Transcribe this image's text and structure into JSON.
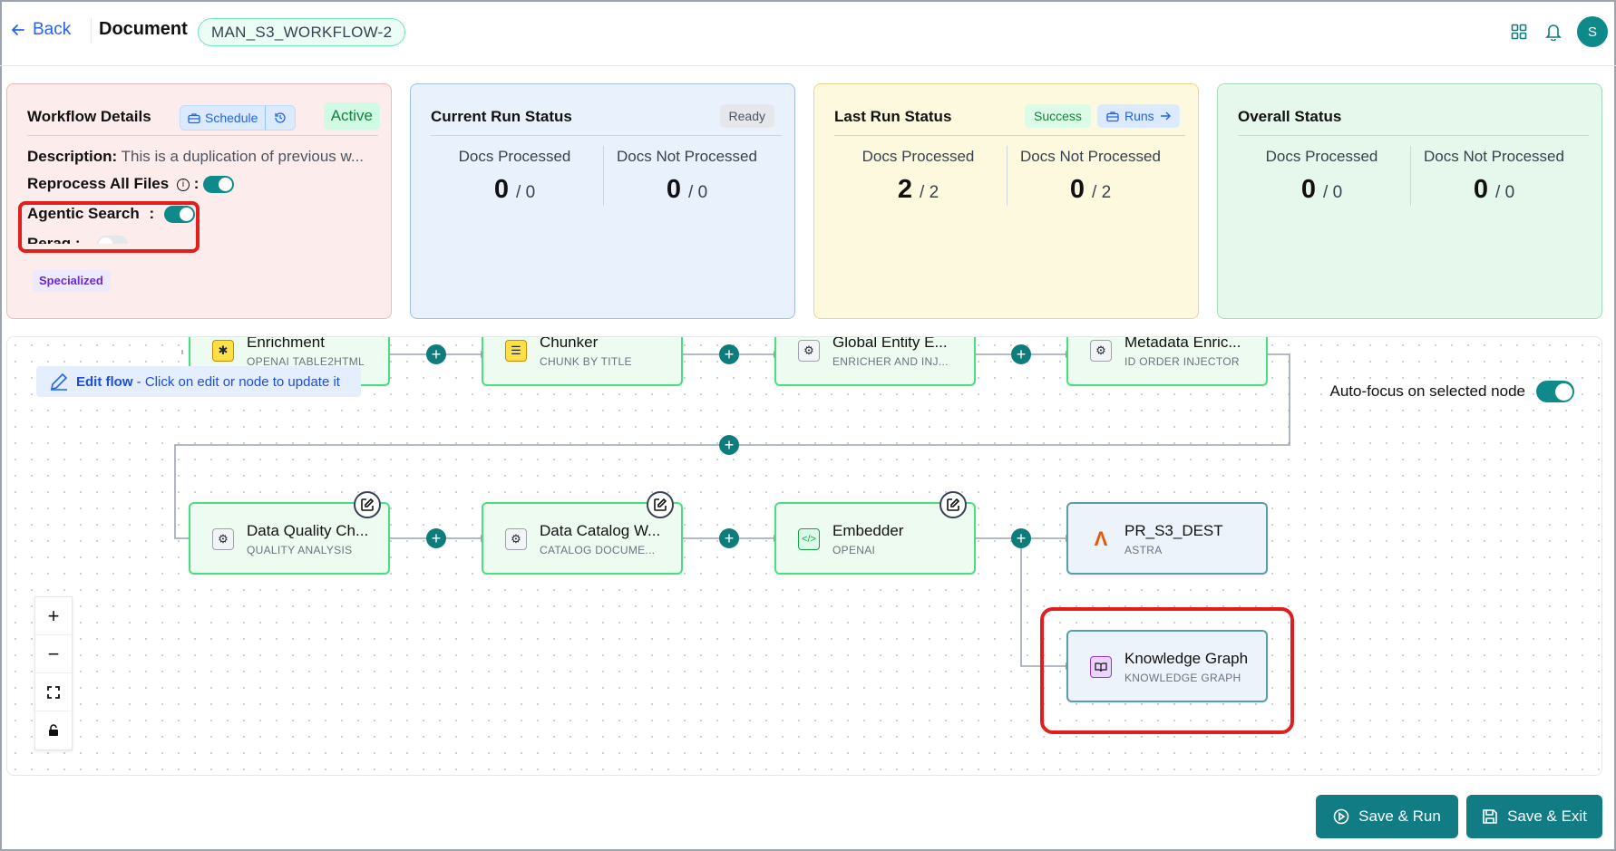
{
  "header": {
    "back_label": "Back",
    "title": "Document",
    "workflow_name": "MAN_S3_WORKFLOW-2",
    "avatar_initial": "S"
  },
  "workflow_details": {
    "title": "Workflow Details",
    "schedule_label": "Schedule",
    "status": "Active",
    "description_label": "Description:",
    "description_value": "This is a duplication of previous w...",
    "reprocess_label": "Reprocess All Files",
    "reprocess_on": true,
    "agentic_search_label": "Agentic Search",
    "agentic_search_on": true,
    "rerag_label": "Rerag",
    "rerag_on": false,
    "tag": "Specialized"
  },
  "current_run": {
    "title": "Current Run Status",
    "badge": "Ready",
    "processed_label": "Docs Processed",
    "processed": "0",
    "processed_total": "/ 0",
    "not_processed_label": "Docs Not Processed",
    "not_processed": "0",
    "not_processed_total": "/ 0"
  },
  "last_run": {
    "title": "Last Run Status",
    "badge": "Success",
    "runs_label": "Runs",
    "processed_label": "Docs Processed",
    "processed": "2",
    "processed_total": "/ 2",
    "not_processed_label": "Docs Not Processed",
    "not_processed": "0",
    "not_processed_total": "/ 2"
  },
  "overall": {
    "title": "Overall Status",
    "processed_label": "Docs Processed",
    "processed": "0",
    "processed_total": "/ 0",
    "not_processed_label": "Docs Not Processed",
    "not_processed": "0",
    "not_processed_total": "/ 0"
  },
  "canvas": {
    "edit_flow_bold": "Edit flow",
    "edit_flow_hint": " - Click on edit or node to update it",
    "autofocus_label": "Auto-focus on selected node",
    "autofocus_on": true,
    "nodes": [
      {
        "title": "Enrichment",
        "subtitle": "OPENAI TABLE2HTML",
        "icon": "star-icon"
      },
      {
        "title": "Chunker",
        "subtitle": "CHUNK BY TITLE",
        "icon": "list-icon"
      },
      {
        "title": "Global Entity E...",
        "subtitle": "ENRICHER AND INJ...",
        "icon": "puzzle-icon"
      },
      {
        "title": "Metadata Enric...",
        "subtitle": "ID ORDER INJECTOR",
        "icon": "puzzle-icon"
      },
      {
        "title": "Data Quality Ch...",
        "subtitle": "QUALITY ANALYSIS",
        "icon": "puzzle-icon"
      },
      {
        "title": "Data Catalog W...",
        "subtitle": "CATALOG DOCUME...",
        "icon": "puzzle-icon"
      },
      {
        "title": "Embedder",
        "subtitle": "OPENAI",
        "icon": "code-icon"
      },
      {
        "title": "PR_S3_DEST",
        "subtitle": "ASTRA",
        "icon": "astra-icon"
      },
      {
        "title": "Knowledge Graph",
        "subtitle": "KNOWLEDGE GRAPH",
        "icon": "book-icon"
      }
    ]
  },
  "footer": {
    "save_run_label": "Save & Run",
    "save_exit_label": "Save & Exit"
  }
}
